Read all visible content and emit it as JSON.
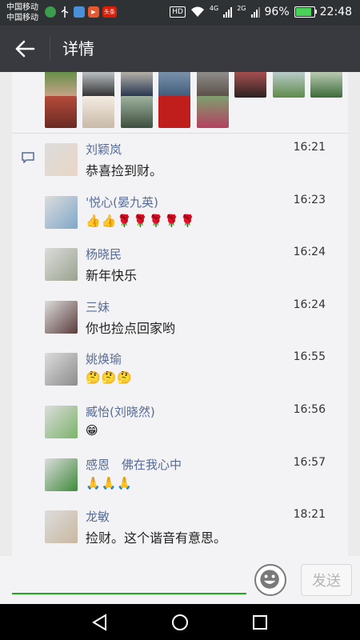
{
  "status_bar": {
    "carrier_1": "中国移动",
    "carrier_2": "中国移动",
    "hd_label": "HD",
    "network_1": "4G",
    "network_2": "2G",
    "battery_percent": "96%",
    "battery_level": 0.96,
    "time": "22:48",
    "app_icons": [
      "globe-icon",
      "usb-icon",
      "camera-icon",
      "video-icon",
      "toutiao-icon"
    ],
    "toutiao_label": "头条"
  },
  "header": {
    "title": "详情"
  },
  "comments": [
    {
      "name": "刘颖岚",
      "time": "16:21",
      "text": "恭喜捡到财。",
      "avatar_color": "#e9d6c6"
    },
    {
      "name": "'悦心(晏九英)",
      "time": "16:23",
      "text": "",
      "emojis": "👍👍🌹🌹🌹🌹🌹",
      "avatar_color": "#7fa7c9"
    },
    {
      "name": "杨晓民",
      "time": "16:24",
      "text": "新年快乐",
      "avatar_color": "#9aa38e"
    },
    {
      "name": "三妹",
      "time": "16:24",
      "text": "你也捡点回家哟",
      "avatar_color": "#5b3b3b"
    },
    {
      "name": "姚焕瑜",
      "time": "16:55",
      "text": "",
      "emojis": "🤔🤔🤔",
      "avatar_color": "#8c8c8c"
    },
    {
      "name": "臧怡(刘晓然)",
      "time": "16:56",
      "text": "",
      "emojis": "😁",
      "avatar_color": "#7bb36a"
    },
    {
      "name": "感恩　佛在我心中",
      "time": "16:57",
      "text": "",
      "emojis": "🙏🙏🙏",
      "avatar_color": "#3f8a3b"
    },
    {
      "name": "龙敏",
      "time": "18:21",
      "text": "捡财。这个谐音有意思。",
      "avatar_color": "#c9b8a0"
    }
  ],
  "input": {
    "value": "",
    "send_label": "发送"
  },
  "colors": {
    "link_blue": "#576b95",
    "wechat_green": "#1aad19",
    "titlebar": "#393a3f"
  }
}
